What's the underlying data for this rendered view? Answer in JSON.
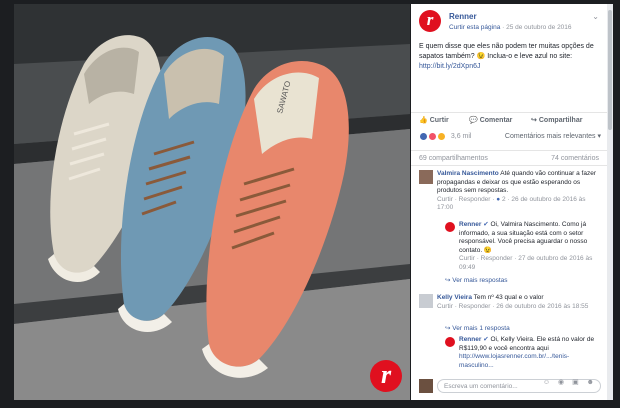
{
  "page": {
    "name": "Renner",
    "follow_link": "Curtir esta página",
    "timestamp": "25 de outubro de 2016",
    "logo_letter": "r",
    "post_text": "E quem disse que eles não podem ter muitas opções de sapatos também? 😉 Inclua-o e leve azul no site:",
    "post_link": "http://bit.ly/2dXpn6J"
  },
  "actions": {
    "like": "Curtir",
    "comment": "Comentar",
    "share": "Compartilhar"
  },
  "reactions": {
    "count": "3,6 mil",
    "sort_label": "Comentários mais relevantes ▾",
    "colors": [
      "#4267b2",
      "#f25268",
      "#f7b125"
    ]
  },
  "stats": {
    "shares": "69 compartilhamentos",
    "comments": "74 comentários"
  },
  "comments": [
    {
      "name": "Valmira Nascimento",
      "text": "Até quando vão continuar a fazer propagandas e deixar os que estão esperando os produtos sem respostas.",
      "links": "Curtir · Responder · ",
      "likes": "2",
      "time": "26 de outubro de 2016 às 17:00"
    },
    {
      "name": "Renner",
      "text": "Oi, Valmira Nascimento. Como já informado, a sua situação está com o setor responsável. Você precisa aguardar o nosso contato. 😉",
      "links": "Curtir · Responder · ",
      "time": "27 de outubro de 2016 às 09:49"
    },
    {
      "name": "Kelly Vieira",
      "text": "Tem nº 43 qual e o valor",
      "links": "Curtir · Responder · ",
      "time": "26 de outubro de 2016 às 18:55"
    },
    {
      "name": "Renner",
      "text": "Oi, Kelly Vieira. Ele está no valor de R$119,90 e você encontra aqui",
      "link": "http://www.lojasrenner.com.br/.../tenis-masculino..."
    }
  ],
  "more_replies_1": "↪ Ver mais respostas",
  "more_replies_2": "↪ Ver mais 1 resposta",
  "composer": {
    "placeholder": "Escreva um comentário...",
    "icons": "☺ ◉ ▣ ☻"
  },
  "photo": {
    "brand_letter": "r",
    "tongue_label": "SAWATO"
  }
}
